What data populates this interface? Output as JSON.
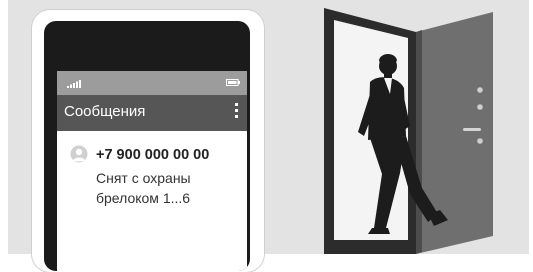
{
  "phone": {
    "app_title": "Сообщения",
    "message": {
      "sender": "+7 900 000 00 00",
      "text_line1": "Снят с охраны",
      "text_line2": "брелоком 1...6"
    }
  },
  "icons": {
    "signal": "signal-icon",
    "battery": "battery-icon",
    "menu": "more-vert-icon",
    "avatar": "contact-avatar-icon"
  },
  "colors": {
    "background": "#e3e3e3",
    "phone_frame": "#1b1b1b",
    "statusbar": "#9c9c9c",
    "appbar": "#565656",
    "door": "#6e6e6e",
    "figure": "#1c1c1c"
  }
}
